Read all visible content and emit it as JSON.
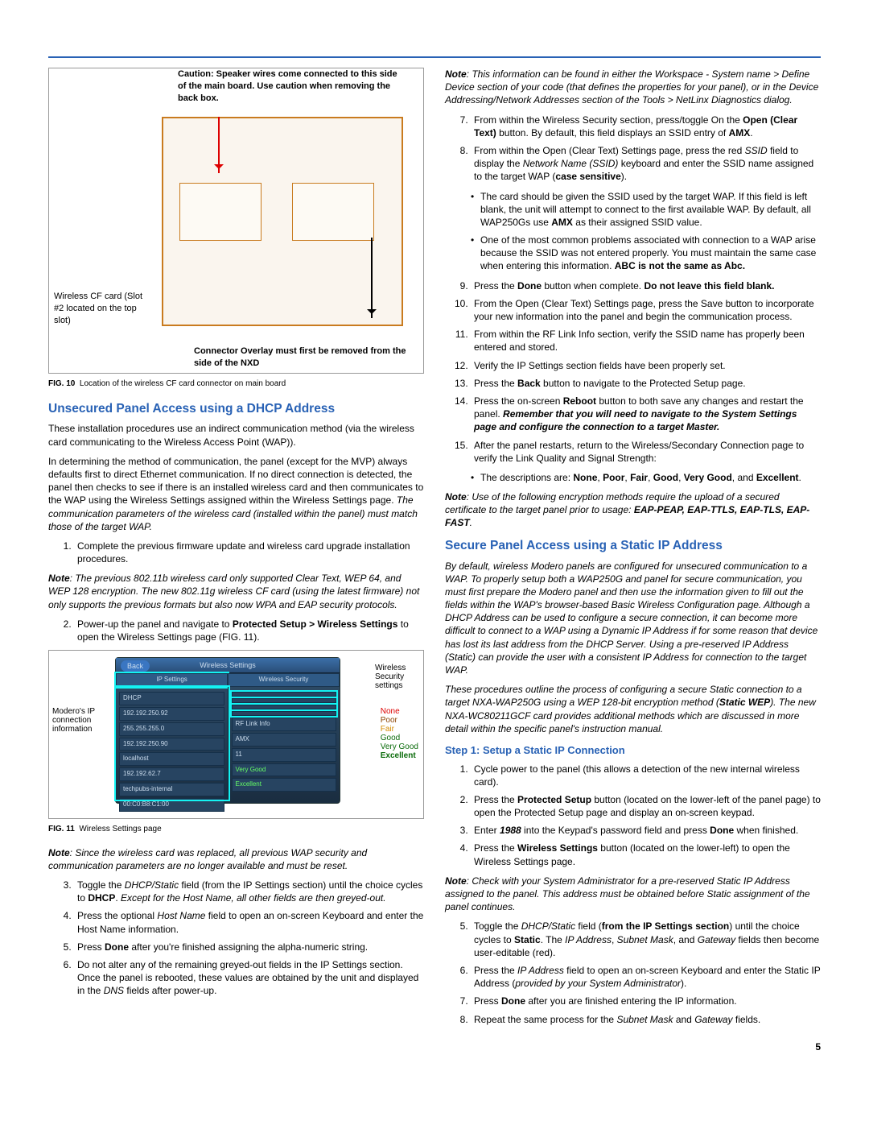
{
  "fig10": {
    "caution": "Caution: Speaker wires come connected to this side of the main board. Use caution when removing the back box.",
    "cf_label": "Wireless CF card (Slot #2 located on the top slot)",
    "overlay": "Connector Overlay must first be removed from the side of the NXD",
    "caption_label": "FIG. 10",
    "caption_text": "Location of the wireless CF card connector on main board"
  },
  "h_unsecured": "Unsecured Panel Access using a DHCP Address",
  "p_unsec_1": "These installation procedures use an indirect communication method (via the wireless card communicating to the Wireless Access Point (WAP)).",
  "p_unsec_2": "In determining the method of communication, the panel (except for the MVP) always defaults first to direct Ethernet communication. If no direct connection is detected, the panel then checks to see if there is an installed wireless card and then communicates to the WAP using the Wireless Settings assigned within the Wireless Settings page. ",
  "p_unsec_2_it": "The communication parameters of the wireless card (installed within the panel) must match those of the target WAP.",
  "ol_a_1": "Complete the previous firmware update and wireless card upgrade installation procedures.",
  "note_a": "Note",
  "note_a_body": ": The previous 802.11b wireless card only supported Clear Text, WEP 64, and WEP 128 encryption. The new 802.11g wireless CF card (using the latest firmware) not only supports the previous formats but also now WPA and EAP security protocols.",
  "ol_a_2_a": "Power-up the panel and navigate to ",
  "ol_a_2_b": "Protected Setup > Wireless Settings",
  "ol_a_2_c": " to open the Wireless Settings page (FIG. 11).",
  "fig11": {
    "left_label": "Modero's IP connection information",
    "right_label": "Wireless Security settings",
    "title": "Wireless Settings",
    "back": "Back",
    "tab_left": "IP Settings",
    "tab_right": "Wireless Security",
    "rows_left": [
      "DHCP",
      "192.192.250.92",
      "255.255.255.0",
      "192.192.250.90",
      "localhost",
      "192.192.62.7",
      "techpubs-internal",
      "00:C0:B8:C1:00"
    ],
    "rows_right": [
      "",
      "",
      "",
      "",
      "RF Link Info",
      "AMX",
      "11",
      "Very Good",
      "Excellent",
      ""
    ],
    "q": [
      "None",
      "Poor",
      "Fair",
      "Good",
      "Very Good",
      "Excellent"
    ],
    "caption_label": "FIG. 11",
    "caption_text": "Wireless Settings page"
  },
  "note_b": "Note",
  "note_b_body": ": Since the wireless card was replaced, all previous WAP security and communication parameters are no longer available and must be reset.",
  "ol_a_3_a": "Toggle the ",
  "ol_a_3_b": "DHCP/Static",
  "ol_a_3_c": " field (from the IP Settings section) until the choice cycles to ",
  "ol_a_3_d": "DHCP",
  "ol_a_3_e": ". ",
  "ol_a_3_f": "Except for the Host Name, all other fields are then greyed-out.",
  "ol_a_4_a": "Press the optional ",
  "ol_a_4_b": "Host Name",
  "ol_a_4_c": " field to open an on-screen Keyboard and enter the Host Name information.",
  "ol_a_5_a": "Press ",
  "ol_a_5_b": "Done",
  "ol_a_5_c": " after you're finished assigning the alpha-numeric string.",
  "ol_a_6_a": "Do not alter any of the remaining greyed-out fields in the IP Settings section. Once the panel is rebooted, these values are obtained by the unit and displayed in the ",
  "ol_a_6_b": "DNS",
  "ol_a_6_c": " fields after power-up.",
  "note_c": "Note",
  "note_c_body": ": This information can be found in either the Workspace - System name > Define Device section of your code (that defines the properties for your panel), or in the Device Addressing/Network Addresses section of the Tools > NetLinx Diagnostics dialog.",
  "ol_b_7_a": "From within the Wireless Security section, press/toggle On the ",
  "ol_b_7_b": "Open (Clear Text)",
  "ol_b_7_c": " button. By default, this field displays an SSID entry of ",
  "ol_b_7_d": "AMX",
  "ol_b_7_e": ".",
  "ol_b_8_a": "From within the Open (Clear Text) Settings page, press the red ",
  "ol_b_8_b": "SSID",
  "ol_b_8_c": " field to display the ",
  "ol_b_8_d": "Network Name (SSID)",
  "ol_b_8_e": " keyboard and enter the SSID name assigned to the target WAP (",
  "ol_b_8_f": "case sensitive",
  "ol_b_8_g": ").",
  "bul8_1_a": "The card should be given the SSID used by the target WAP. If this field is left blank, the unit will attempt to connect to the first available WAP. By default, all WAP250Gs use ",
  "bul8_1_b": "AMX",
  "bul8_1_c": " as their assigned SSID value.",
  "bul8_2_a": "One of the most common problems associated with connection to a WAP arise because the SSID was not entered properly. You must maintain the same case when entering this information. ",
  "bul8_2_b": "ABC is not the same as Abc.",
  "ol_b_9_a": "Press the ",
  "ol_b_9_b": "Done",
  "ol_b_9_c": " button when complete. ",
  "ol_b_9_d": "Do not leave this field blank.",
  "ol_b_10": "From the Open (Clear Text) Settings page, press the Save button to incorporate your new information into the panel and begin the communication process.",
  "ol_b_11": "From within the RF Link Info section, verify the SSID name has properly been entered and stored.",
  "ol_b_12": "Verify the IP Settings section fields have been properly set.",
  "ol_b_13_a": "Press the ",
  "ol_b_13_b": "Back",
  "ol_b_13_c": " button to navigate to the Protected Setup page.",
  "ol_b_14_a": "Press the on-screen ",
  "ol_b_14_b": "Reboot",
  "ol_b_14_c": " button to both save any changes and restart the panel. ",
  "ol_b_14_d": "Remember that you will need to navigate to the System Settings page and configure the connection to a target Master.",
  "ol_b_15": "After the panel restarts, return to the Wireless/Secondary Connection page to verify the Link Quality and Signal Strength:",
  "bul15_a": "The descriptions are: ",
  "bul15_b": "None",
  "bul15_c": "Poor",
  "bul15_d": "Fair",
  "bul15_e": "Good",
  "bul15_f": "Very Good",
  "bul15_g": "Excellent",
  "note_d": "Note",
  "note_d_body": ": Use of the following encryption methods require the upload of a secured certificate to the target panel prior to usage: ",
  "note_d_bold": "EAP-PEAP, EAP-TTLS, EAP-TLS, EAP-FAST",
  "h_secure": "Secure Panel Access using a Static IP Address",
  "p_sec_intro": "By default, wireless Modero panels are configured for unsecured communication to a WAP. To properly setup both a WAP250G and panel for secure communication, you must first prepare the Modero panel and then use the information given to fill out the fields within the WAP's browser-based Basic Wireless Configuration page. Although a DHCP Address can be used to configure a secure connection, it can become more difficult to connect to a WAP using a Dynamic IP Address if for some reason that device has lost its last address from the DHCP Server. Using a pre-reserved IP Address (Static) can provide the user with a consistent IP Address for connection to the target WAP.",
  "p_sec_outline": "These procedures outline the process of configuring a secure Static connection to a target NXA-WAP250G using a WEP 128-bit encryption method (",
  "p_sec_outline_b": "Static WEP",
  "p_sec_outline_c": "). The new NXA-WC80211GCF card provides additional methods which are discussed in more detail within the specific panel's instruction manual.",
  "h_step1": "Step 1: Setup a Static IP Connection",
  "ol_c_1": "Cycle power to the panel (this allows a detection of the new internal wireless card).",
  "ol_c_2_a": "Press the ",
  "ol_c_2_b": "Protected Setup",
  "ol_c_2_c": " button (located on the lower-left of the panel page) to open the Protected Setup page and display an on-screen keypad.",
  "ol_c_3_a": "Enter ",
  "ol_c_3_b": "1988",
  "ol_c_3_c": " into the Keypad's password field and press ",
  "ol_c_3_d": "Done",
  "ol_c_3_e": " when finished.",
  "ol_c_4_a": "Press the ",
  "ol_c_4_b": "Wireless Settings",
  "ol_c_4_c": " button (located on the lower-left) to open the Wireless Settings page.",
  "note_e": "Note",
  "note_e_body": ": Check with your System Administrator for a pre-reserved Static IP Address assigned to the panel. This address must be obtained before Static assignment of the panel continues.",
  "ol_c_5_a": "Toggle the ",
  "ol_c_5_b": "DHCP/Static",
  "ol_c_5_c": " field (",
  "ol_c_5_d": "from the IP Settings section",
  "ol_c_5_e": ") until the choice cycles to ",
  "ol_c_5_f": "Static",
  "ol_c_5_g": ". The ",
  "ol_c_5_h": "IP Address",
  "ol_c_5_i": ", ",
  "ol_c_5_j": "Subnet Mask",
  "ol_c_5_k": ", and ",
  "ol_c_5_l": "Gateway",
  "ol_c_5_m": " fields then become user-editable (red).",
  "ol_c_6_a": "Press the ",
  "ol_c_6_b": "IP Address",
  "ol_c_6_c": " field to open an on-screen Keyboard and enter the Static IP Address (",
  "ol_c_6_d": "provided by your System Administrator",
  "ol_c_6_e": ").",
  "ol_c_7_a": "Press ",
  "ol_c_7_b": "Done",
  "ol_c_7_c": " after you are finished entering the IP information.",
  "ol_c_8_a": "Repeat the same process for the ",
  "ol_c_8_b": "Subnet Mask",
  "ol_c_8_c": " and ",
  "ol_c_8_d": "Gateway",
  "ol_c_8_e": " fields.",
  "page_number": "5"
}
